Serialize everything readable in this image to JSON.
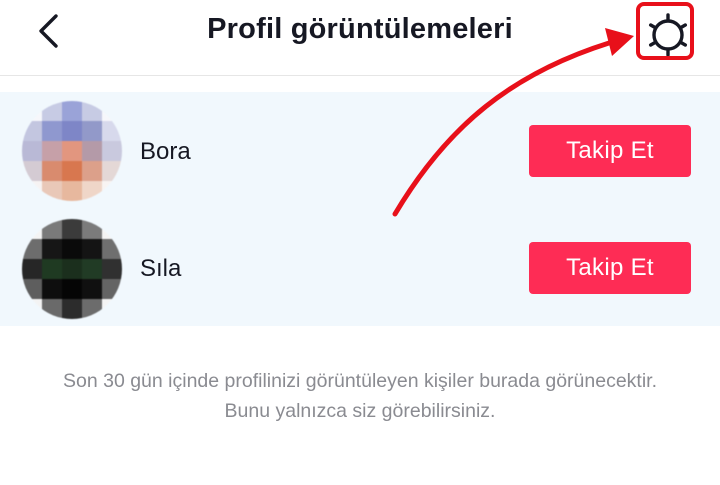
{
  "header": {
    "title": "Profil görüntülemeleri",
    "back_icon": "chevron-left-icon",
    "settings_icon": "gear-icon"
  },
  "viewers": [
    {
      "name": "Bora",
      "follow_label": "Takip Et",
      "avatar_colors": [
        "#f6f7fb",
        "#c7cbe4",
        "#9aa3d8",
        "#c7cbe4",
        "#f6f7fb",
        "#c3c6e0",
        "#8f98cf",
        "#7e86c7",
        "#9299c9",
        "#d7d9ec",
        "#b9b9d6",
        "#c6a0a8",
        "#e2967f",
        "#b49aa8",
        "#c9c9de",
        "#d4cbd3",
        "#d98b6e",
        "#d8774f",
        "#dca08a",
        "#e4d8d6",
        "#f6f3f3",
        "#e9c8b8",
        "#e7b89e",
        "#efd6c8",
        "#f8f4f2"
      ]
    },
    {
      "name": "Sıla",
      "follow_label": "Takip Et",
      "avatar_colors": [
        "#f4f4f4",
        "#7a7a7a",
        "#3b3b3b",
        "#7b7b7b",
        "#f4f4f4",
        "#6d6d6d",
        "#161616",
        "#0a0a0a",
        "#141414",
        "#6f6f6f",
        "#262626",
        "#1f3a22",
        "#1b2f1d",
        "#213b25",
        "#303030",
        "#5e5e5e",
        "#0e0e0e",
        "#050505",
        "#101010",
        "#646464",
        "#f3f3f3",
        "#6a6a6a",
        "#2c2c2c",
        "#6c6c6c",
        "#f4f4f4"
      ]
    }
  ],
  "footer_note": "Son 30 gün içinde profilinizi görüntüleyen kişiler burada görünecektir. Bunu yalnızca siz görebilirsiniz.",
  "colors": {
    "accent": "#fe2c55",
    "annotation": "#e8101a",
    "list_background": "#f1f8fd"
  }
}
